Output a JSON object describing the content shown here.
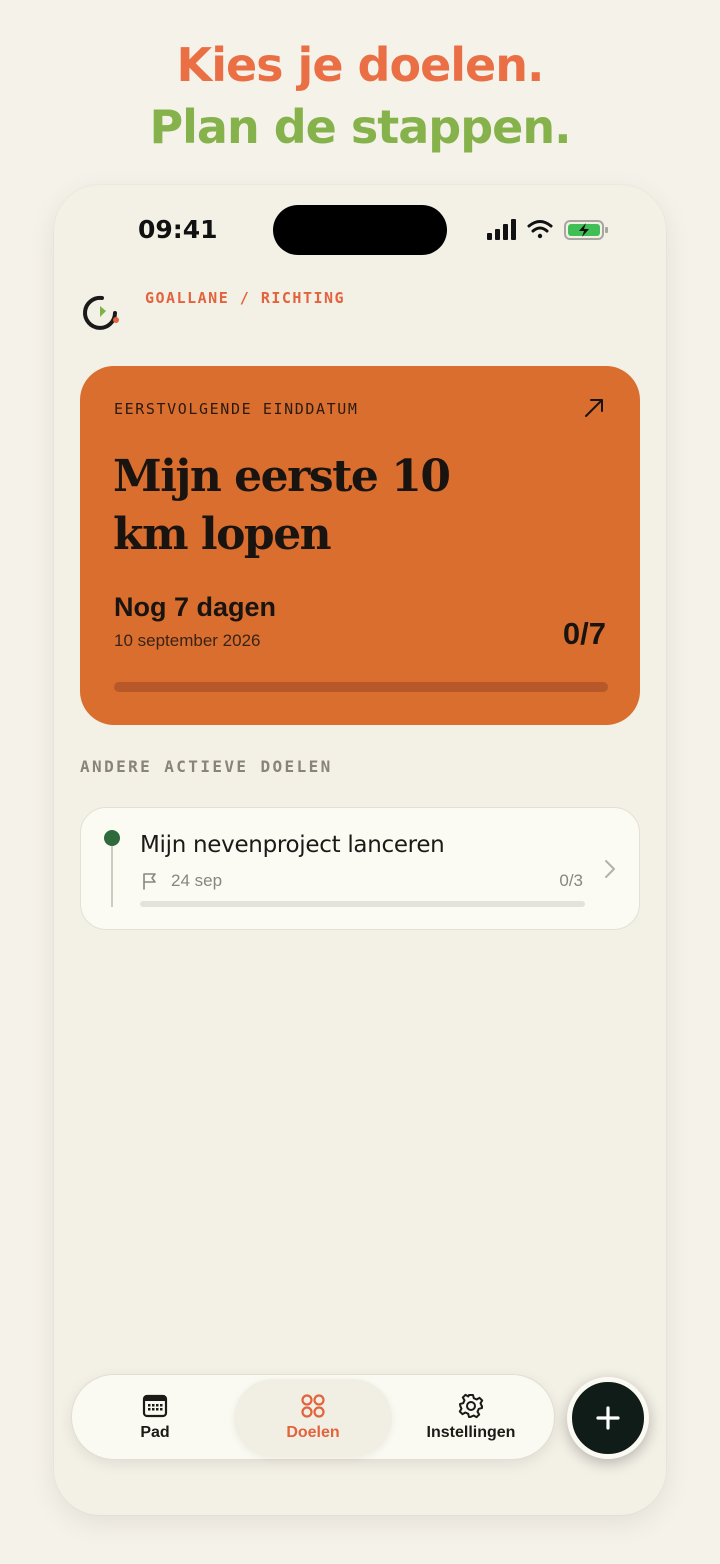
{
  "headline": {
    "line1": "Kies je doelen.",
    "line2": "Plan de stappen."
  },
  "status_bar": {
    "time": "09:41"
  },
  "header": {
    "breadcrumb": "GOALLANE / RICHTING"
  },
  "hero": {
    "kicker": "EERSTVOLGENDE EINDDATUM",
    "title": "Mijn eerste 10 km lopen",
    "countdown": "Nog 7 dagen",
    "date": "10 september 2026",
    "progress_text": "0/7",
    "progress_fraction": 0
  },
  "section_label": "ANDERE ACTIEVE DOELEN",
  "goals": [
    {
      "title": "Mijn nevenproject lanceren",
      "date": "24 sep",
      "progress_text": "0/3",
      "progress_fraction": 0
    }
  ],
  "tabbar": {
    "tabs": [
      {
        "label": "Pad",
        "icon": "calendar-icon",
        "active": false
      },
      {
        "label": "Doelen",
        "icon": "grid-circles-icon",
        "active": true
      },
      {
        "label": "Instellingen",
        "icon": "gear-icon",
        "active": false
      }
    ]
  },
  "colors": {
    "accent": "#e2633d",
    "hero_bg": "#d96e2f",
    "headline_orange": "#ea6f45",
    "headline_green": "#86b24b",
    "goal_dot": "#2f6a3d",
    "fab_bg": "#101c17"
  },
  "icons": {
    "fab": "plus-icon",
    "hero_link": "arrow-up-right-icon",
    "goal_flag": "flag-icon",
    "goal_chevron": "chevron-right-icon"
  }
}
